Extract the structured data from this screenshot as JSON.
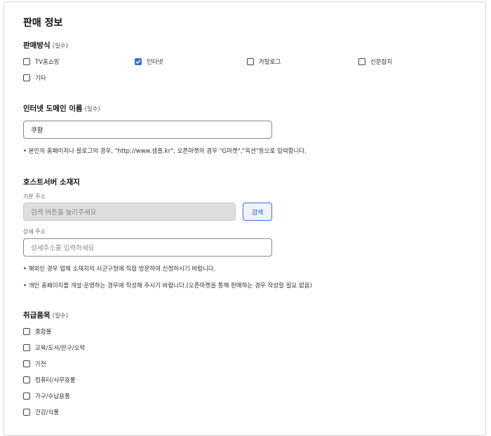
{
  "page_title": "판매 정보",
  "sales_method": {
    "label": "판매방식",
    "required": "(필수)",
    "options": [
      {
        "label": "TV홈쇼핑",
        "checked": false
      },
      {
        "label": "인터넷",
        "checked": true
      },
      {
        "label": "카탈로그",
        "checked": false
      },
      {
        "label": "신문잡지",
        "checked": false
      },
      {
        "label": "기타",
        "checked": false
      }
    ]
  },
  "domain_name": {
    "label": "인터넷 도메인 이름",
    "required": "(필수)",
    "value": "쿠팡",
    "note": "• 본인의 홈페이지나 블로그의 경우, \"http://www.샘플.kr\", 오픈마켓의 경우 \"G마켓\",\"옥션\"등으로 입력합니다."
  },
  "host_server": {
    "label": "호스트서버 소재지",
    "basic_address_label": "기본 주소",
    "basic_address_placeholder": "검색 버튼을 눌러주세요",
    "search_button": "검색",
    "detail_address_label": "상세 주소",
    "detail_address_placeholder": "상세주소를 입력하세요",
    "note1": "• 해외인 경우 업체 소재지의 시군구청에 직접 방문하여 신청하시기 바랍니다.",
    "note2": "• 개인 홈페이지를 개설·운영하는 경우에 작성해 주시기 바랍니다.(오픈마켓을 통해 판매하는 경우 작성할 필요 없음)"
  },
  "product_category": {
    "label": "취급품목",
    "required": "(필수)",
    "options": [
      {
        "label": "종합몰",
        "checked": false
      },
      {
        "label": "교육/도서/완구/오락",
        "checked": false
      },
      {
        "label": "가전",
        "checked": false
      },
      {
        "label": "컴퓨터/사무용품",
        "checked": false
      },
      {
        "label": "가구/수납용품",
        "checked": false
      },
      {
        "label": "건강/식품",
        "checked": false
      }
    ]
  },
  "colors": {
    "accent": "#3b6fd6",
    "disabled_bg": "#dedede"
  }
}
